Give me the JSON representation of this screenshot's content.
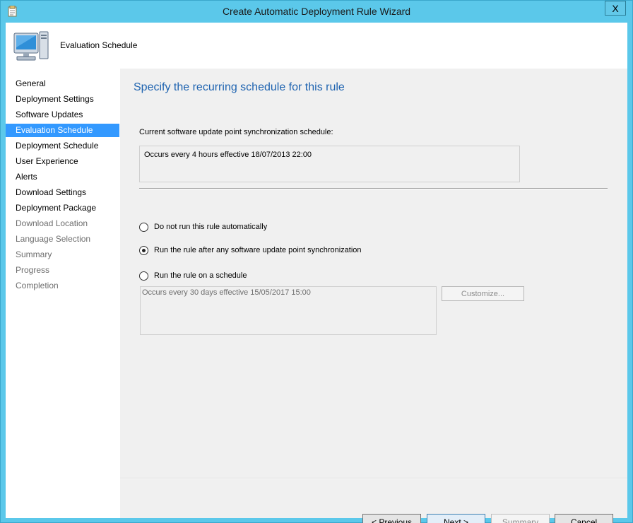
{
  "window": {
    "title": "Create Automatic Deployment Rule Wizard",
    "close_glyph": "X"
  },
  "header": {
    "title": "Evaluation Schedule"
  },
  "nav": {
    "items": [
      {
        "label": "General",
        "state": "normal"
      },
      {
        "label": "Deployment Settings",
        "state": "normal"
      },
      {
        "label": "Software Updates",
        "state": "normal"
      },
      {
        "label": "Evaluation Schedule",
        "state": "active"
      },
      {
        "label": "Deployment Schedule",
        "state": "normal"
      },
      {
        "label": "User Experience",
        "state": "normal"
      },
      {
        "label": "Alerts",
        "state": "normal"
      },
      {
        "label": "Download Settings",
        "state": "normal"
      },
      {
        "label": "Deployment Package",
        "state": "normal"
      },
      {
        "label": "Download Location",
        "state": "disabled"
      },
      {
        "label": "Language Selection",
        "state": "disabled"
      },
      {
        "label": "Summary",
        "state": "disabled"
      },
      {
        "label": "Progress",
        "state": "disabled"
      },
      {
        "label": "Completion",
        "state": "disabled"
      }
    ]
  },
  "main": {
    "heading": "Specify the recurring schedule for this rule",
    "sync_label": "Current software update point synchronization schedule:",
    "sync_value": "Occurs every 4 hours effective 18/07/2013 22:00",
    "options": [
      {
        "label": "Do not run this rule automatically",
        "checked": false
      },
      {
        "label": "Run the rule after any software update point synchronization",
        "checked": true
      },
      {
        "label": "Run the rule on a schedule",
        "checked": false
      }
    ],
    "schedule_value": "Occurs every 30 days effective 15/05/2017 15:00",
    "customize_label": "Customize..."
  },
  "footer": {
    "previous_label": "< Previous",
    "next_label": "Next >",
    "summary_label": "Summary",
    "cancel_label": "Cancel"
  },
  "colors": {
    "frame": "#5bc8ea",
    "heading": "#1e63b0",
    "nav_active": "#3399ff"
  }
}
